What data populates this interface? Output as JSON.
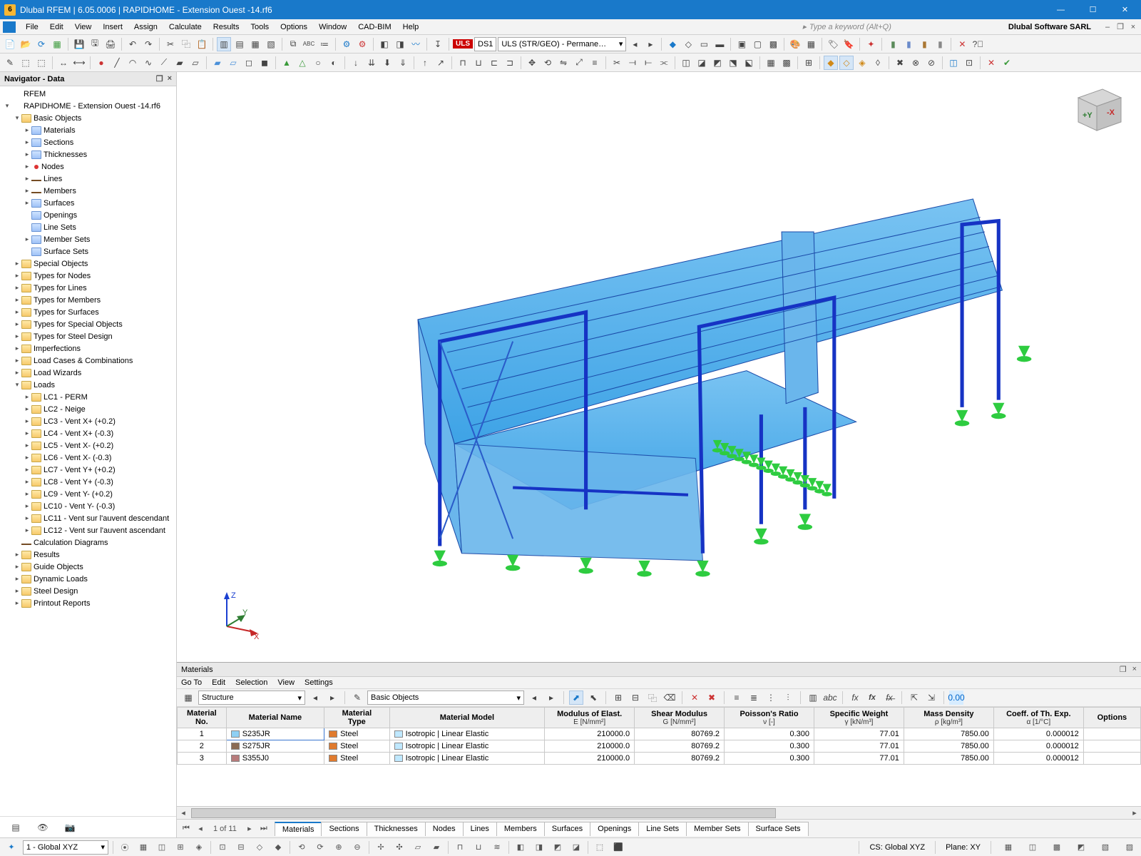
{
  "window": {
    "title": "Dlubal RFEM | 6.05.0006 | RAPIDHOME - Extension Ouest -14.rf6",
    "brand": "Dlubal Software SARL"
  },
  "menu": {
    "items": [
      "File",
      "Edit",
      "View",
      "Insert",
      "Assign",
      "Calculate",
      "Results",
      "Tools",
      "Options",
      "Window",
      "CAD-BIM",
      "Help"
    ],
    "search_placeholder": "Type a keyword (Alt+Q)"
  },
  "toolbar1": {
    "ds_label": "DS1",
    "combo_label": "ULS (STR/GEO) - Permane…",
    "uls": "ULS"
  },
  "navigator": {
    "title": "Navigator - Data",
    "root": "RFEM",
    "model": "RAPIDHOME - Extension Ouest -14.rf6",
    "basic_objects_label": "Basic Objects",
    "basic_objects": [
      "Materials",
      "Sections",
      "Thicknesses",
      "Nodes",
      "Lines",
      "Members",
      "Surfaces",
      "Openings",
      "Line Sets",
      "Member Sets",
      "Surface Sets"
    ],
    "middle_groups": [
      "Special Objects",
      "Types for Nodes",
      "Types for Lines",
      "Types for Members",
      "Types for Surfaces",
      "Types for Special Objects",
      "Types for Steel Design",
      "Imperfections",
      "Load Cases & Combinations",
      "Load Wizards"
    ],
    "loads_label": "Loads",
    "loads": [
      "LC1 - PERM",
      "LC2 - Neige",
      "LC3 - Vent X+ (+0.2)",
      "LC4 - Vent X+ (-0.3)",
      "LC5 - Vent X- (+0.2)",
      "LC6 - Vent X- (-0.3)",
      "LC7 - Vent Y+ (+0.2)",
      "LC8 - Vent Y+ (-0.3)",
      "LC9 - Vent Y- (+0.2)",
      "LC10 - Vent Y- (-0.3)",
      "LC11 - Vent sur l'auvent descendant",
      "LC12 - Vent sur l'auvent ascendant"
    ],
    "calc_diagrams": "Calculation Diagrams",
    "bottom_groups": [
      "Results",
      "Guide Objects",
      "Dynamic Loads",
      "Steel Design",
      "Printout Reports"
    ]
  },
  "viewport": {
    "axes": {
      "x": "X",
      "y": "Y",
      "z": "Z"
    },
    "cube": {
      "py": "+Y",
      "mx": "-X"
    }
  },
  "panel": {
    "title": "Materials",
    "menu": [
      "Go To",
      "Edit",
      "Selection",
      "View",
      "Settings"
    ],
    "combo1": "Structure",
    "combo2": "Basic Objects",
    "headers": {
      "no": "Material\nNo.",
      "name": "Material Name",
      "type": "Material\nType",
      "model": "Material Model",
      "E": {
        "t": "Modulus of Elast.",
        "s": "E [N/mm²]"
      },
      "G": {
        "t": "Shear Modulus",
        "s": "G [N/mm²]"
      },
      "v": {
        "t": "Poisson's Ratio",
        "s": "ν [-]"
      },
      "gamma": {
        "t": "Specific Weight",
        "s": "γ [kN/m³]"
      },
      "rho": {
        "t": "Mass Density",
        "s": "ρ [kg/m³]"
      },
      "alpha": {
        "t": "Coeff. of Th. Exp.",
        "s": "α [1/°C]"
      },
      "opt": "Options"
    },
    "rows": [
      {
        "no": "1",
        "name": "S235JR",
        "color": "#8fd0f4",
        "type": "Steel",
        "tcolor": "#e07b2e",
        "model": "Isotropic | Linear Elastic",
        "mcolor": "#bfe8ff",
        "E": "210000.0",
        "G": "80769.2",
        "v": "0.300",
        "gamma": "77.01",
        "rho": "7850.00",
        "alpha": "0.000012"
      },
      {
        "no": "2",
        "name": "S275JR",
        "color": "#8a6b55",
        "type": "Steel",
        "tcolor": "#e07b2e",
        "model": "Isotropic | Linear Elastic",
        "mcolor": "#bfe8ff",
        "E": "210000.0",
        "G": "80769.2",
        "v": "0.300",
        "gamma": "77.01",
        "rho": "7850.00",
        "alpha": "0.000012"
      },
      {
        "no": "3",
        "name": "S355J0",
        "color": "#b77b7b",
        "type": "Steel",
        "tcolor": "#e07b2e",
        "model": "Isotropic | Linear Elastic",
        "mcolor": "#bfe8ff",
        "E": "210000.0",
        "G": "80769.2",
        "v": "0.300",
        "gamma": "77.01",
        "rho": "7850.00",
        "alpha": "0.000012"
      }
    ]
  },
  "tabs": {
    "page_info": "1 of 11",
    "items": [
      "Materials",
      "Sections",
      "Thicknesses",
      "Nodes",
      "Lines",
      "Members",
      "Surfaces",
      "Openings",
      "Line Sets",
      "Member Sets",
      "Surface Sets"
    ],
    "active": 0
  },
  "status": {
    "cs_dropdown": "1 - Global XYZ",
    "cs_label": "CS: Global XYZ",
    "plane_label": "Plane: XY"
  }
}
